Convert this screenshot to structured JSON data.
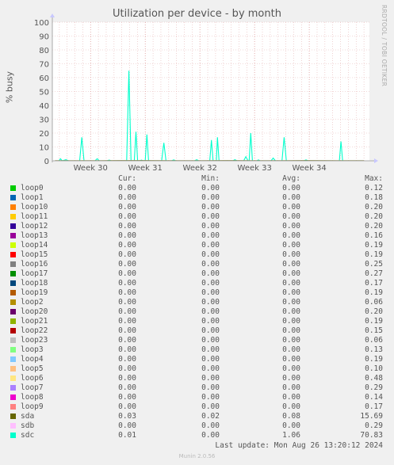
{
  "side_label": "RRDTOOL / TOBI OETIKER",
  "footer": {
    "last_update": "Last update: Mon Aug 26 13:20:12 2024",
    "version": "Munin 2.0.56"
  },
  "legend_headers": {
    "cur": "Cur:",
    "min": "Min:",
    "avg": "Avg:",
    "max": "Max:"
  },
  "legend": [
    {
      "name": "loop0",
      "color": "#00cc00",
      "cur": "0.00",
      "min": "0.00",
      "avg": "0.00",
      "max": "0.12"
    },
    {
      "name": "loop1",
      "color": "#0066b3",
      "cur": "0.00",
      "min": "0.00",
      "avg": "0.00",
      "max": "0.18"
    },
    {
      "name": "loop10",
      "color": "#ff8000",
      "cur": "0.00",
      "min": "0.00",
      "avg": "0.00",
      "max": "0.20"
    },
    {
      "name": "loop11",
      "color": "#ffcc00",
      "cur": "0.00",
      "min": "0.00",
      "avg": "0.00",
      "max": "0.20"
    },
    {
      "name": "loop12",
      "color": "#330099",
      "cur": "0.00",
      "min": "0.00",
      "avg": "0.00",
      "max": "0.20"
    },
    {
      "name": "loop13",
      "color": "#990099",
      "cur": "0.00",
      "min": "0.00",
      "avg": "0.00",
      "max": "0.16"
    },
    {
      "name": "loop14",
      "color": "#ccff00",
      "cur": "0.00",
      "min": "0.00",
      "avg": "0.00",
      "max": "0.19"
    },
    {
      "name": "loop15",
      "color": "#ff0000",
      "cur": "0.00",
      "min": "0.00",
      "avg": "0.00",
      "max": "0.19"
    },
    {
      "name": "loop16",
      "color": "#808080",
      "cur": "0.00",
      "min": "0.00",
      "avg": "0.00",
      "max": "0.25"
    },
    {
      "name": "loop17",
      "color": "#008f00",
      "cur": "0.00",
      "min": "0.00",
      "avg": "0.00",
      "max": "0.27"
    },
    {
      "name": "loop18",
      "color": "#00487d",
      "cur": "0.00",
      "min": "0.00",
      "avg": "0.00",
      "max": "0.17"
    },
    {
      "name": "loop19",
      "color": "#b35a00",
      "cur": "0.00",
      "min": "0.00",
      "avg": "0.00",
      "max": "0.19"
    },
    {
      "name": "loop2",
      "color": "#b38f00",
      "cur": "0.00",
      "min": "0.00",
      "avg": "0.00",
      "max": "0.06"
    },
    {
      "name": "loop20",
      "color": "#6b006b",
      "cur": "0.00",
      "min": "0.00",
      "avg": "0.00",
      "max": "0.20"
    },
    {
      "name": "loop21",
      "color": "#8fb300",
      "cur": "0.00",
      "min": "0.00",
      "avg": "0.00",
      "max": "0.19"
    },
    {
      "name": "loop22",
      "color": "#b30000",
      "cur": "0.00",
      "min": "0.00",
      "avg": "0.00",
      "max": "0.15"
    },
    {
      "name": "loop23",
      "color": "#bebebe",
      "cur": "0.00",
      "min": "0.00",
      "avg": "0.00",
      "max": "0.06"
    },
    {
      "name": "loop3",
      "color": "#80ff80",
      "cur": "0.00",
      "min": "0.00",
      "avg": "0.00",
      "max": "0.13"
    },
    {
      "name": "loop4",
      "color": "#80c9ff",
      "cur": "0.00",
      "min": "0.00",
      "avg": "0.00",
      "max": "0.19"
    },
    {
      "name": "loop5",
      "color": "#ffc080",
      "cur": "0.00",
      "min": "0.00",
      "avg": "0.00",
      "max": "0.10"
    },
    {
      "name": "loop6",
      "color": "#ffe680",
      "cur": "0.00",
      "min": "0.00",
      "avg": "0.00",
      "max": "0.48"
    },
    {
      "name": "loop7",
      "color": "#aa80ff",
      "cur": "0.00",
      "min": "0.00",
      "avg": "0.00",
      "max": "0.29"
    },
    {
      "name": "loop8",
      "color": "#ee00cc",
      "cur": "0.00",
      "min": "0.00",
      "avg": "0.00",
      "max": "0.14"
    },
    {
      "name": "loop9",
      "color": "#ff8080",
      "cur": "0.00",
      "min": "0.00",
      "avg": "0.00",
      "max": "0.17"
    },
    {
      "name": "sda",
      "color": "#666600",
      "cur": "0.03",
      "min": "0.02",
      "avg": "0.08",
      "max": "15.69"
    },
    {
      "name": "sdb",
      "color": "#ffbfff",
      "cur": "0.00",
      "min": "0.00",
      "avg": "0.00",
      "max": "0.29"
    },
    {
      "name": "sdc",
      "color": "#00ffcc",
      "cur": "0.01",
      "min": "0.00",
      "avg": "1.06",
      "max": "70.83"
    }
  ],
  "chart_data": {
    "type": "line",
    "title": "Utilization per device - by month",
    "ylabel": "% busy",
    "xlabel": "",
    "ylim": [
      0,
      100
    ],
    "yticks": [
      0,
      10,
      20,
      30,
      40,
      50,
      60,
      70,
      80,
      90,
      100
    ],
    "xlim": [
      29.3,
      35.1
    ],
    "xticks": [
      {
        "label": "Week 30",
        "x": 30
      },
      {
        "label": "Week 31",
        "x": 31
      },
      {
        "label": "Week 32",
        "x": 32
      },
      {
        "label": "Week 33",
        "x": 33
      },
      {
        "label": "Week 34",
        "x": 34
      }
    ],
    "grid": true,
    "series": [
      {
        "name": "sdc",
        "color": "#00ffcc",
        "x": [
          29.35,
          29.42,
          29.45,
          29.48,
          29.55,
          29.6,
          29.8,
          29.84,
          29.88,
          30.08,
          30.12,
          30.16,
          30.3,
          30.34,
          30.38,
          30.66,
          30.7,
          30.74,
          30.8,
          30.83,
          30.86,
          30.9,
          30.93,
          30.96,
          31.0,
          31.03,
          31.06,
          31.1,
          31.3,
          31.34,
          31.38,
          31.48,
          31.52,
          31.56,
          31.9,
          31.94,
          31.98,
          32.18,
          32.21,
          32.24,
          32.3,
          32.32,
          32.35,
          32.38,
          32.6,
          32.64,
          32.68,
          32.8,
          32.84,
          32.88,
          32.9,
          32.93,
          32.96,
          33.04,
          33.07,
          33.1,
          33.3,
          33.34,
          33.38,
          33.5,
          33.54,
          33.58,
          33.9,
          33.94,
          33.98,
          34.55,
          34.58,
          34.61,
          35.0
        ],
        "y": [
          0,
          0,
          1.5,
          0,
          0.8,
          0,
          0,
          17,
          0,
          0,
          1.5,
          0,
          0,
          0.5,
          0,
          0,
          65,
          0,
          0,
          21,
          0,
          0,
          0.5,
          0,
          0,
          19,
          0,
          0,
          0,
          13,
          0,
          0,
          0.6,
          0,
          0,
          0.8,
          0,
          0,
          15,
          0,
          0,
          17,
          0,
          0,
          0,
          0.8,
          0,
          0,
          3,
          0,
          0,
          20,
          0,
          0,
          0.6,
          0,
          0,
          2,
          0,
          0,
          17,
          0,
          0,
          0.6,
          0,
          0,
          14,
          0,
          0
        ]
      },
      {
        "name": "sda",
        "color": "#666600",
        "x": [
          29.35,
          30.0,
          30.5,
          31.0,
          31.5,
          32.0,
          32.5,
          33.0,
          33.5,
          34.0,
          34.5,
          35.0
        ],
        "y": [
          0.1,
          0.1,
          0.2,
          0.2,
          0.1,
          0.1,
          0.2,
          0.1,
          0.1,
          0.2,
          0.1,
          0.1
        ]
      }
    ]
  }
}
